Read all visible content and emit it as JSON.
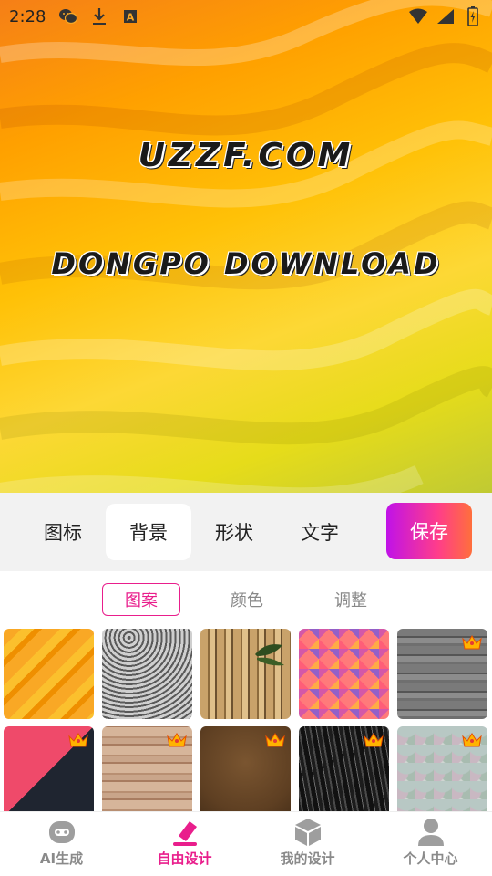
{
  "status_bar": {
    "time": "2:28",
    "icons": [
      "wechat-icon",
      "download-icon",
      "a-letter-icon",
      "wifi-icon",
      "signal-icon",
      "battery-charging-icon"
    ]
  },
  "canvas": {
    "text_line_1": "UZZF.COM",
    "text_line_2": "DONGPO DOWNLOAD",
    "background": "yellow-orange-waves"
  },
  "toolbar": {
    "tabs": [
      {
        "label": "图标",
        "active": false
      },
      {
        "label": "背景",
        "active": true
      },
      {
        "label": "形状",
        "active": false
      },
      {
        "label": "文字",
        "active": false
      }
    ],
    "save_label": "保存"
  },
  "subtabs": [
    {
      "label": "图案",
      "active": true
    },
    {
      "label": "颜色",
      "active": false
    },
    {
      "label": "调整",
      "active": false
    }
  ],
  "patterns": [
    {
      "name": "yellow-waves",
      "premium": false
    },
    {
      "name": "gray-rings",
      "premium": false
    },
    {
      "name": "bamboo",
      "premium": false
    },
    {
      "name": "color-triangles",
      "premium": false
    },
    {
      "name": "gray-wood",
      "premium": true
    },
    {
      "name": "dark-pink-diagonal",
      "premium": true
    },
    {
      "name": "light-wood",
      "premium": true
    },
    {
      "name": "brown-paper",
      "premium": true
    },
    {
      "name": "black-bark",
      "premium": true
    },
    {
      "name": "pastel-scales",
      "premium": true
    }
  ],
  "bottom_nav": [
    {
      "label": "AI生成",
      "icon": "robot-icon",
      "active": false
    },
    {
      "label": "自由设计",
      "icon": "pen-icon",
      "active": true
    },
    {
      "label": "我的设计",
      "icon": "cube-icon",
      "active": false
    },
    {
      "label": "个人中心",
      "icon": "person-icon",
      "active": false
    }
  ],
  "colors": {
    "accent": "#e91e8c",
    "save_gradient_start": "#c012e8",
    "save_gradient_end": "#ff6f3c"
  }
}
